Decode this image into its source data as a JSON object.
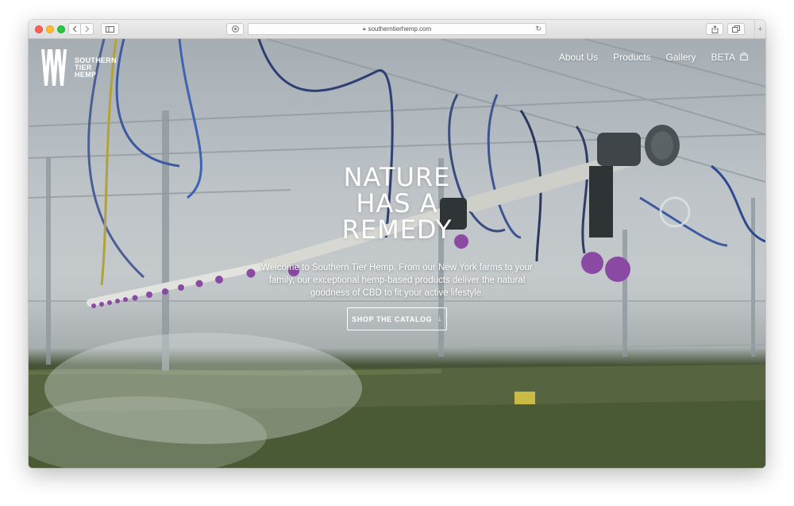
{
  "browser": {
    "url": "southerntierhemp.com",
    "icons": {
      "back": "chevron-left-icon",
      "forward": "chevron-right-icon",
      "sidebar": "sidebar-icon",
      "reader": "reader-icon",
      "lock": "lock-icon",
      "reload": "reload-icon",
      "share": "share-icon",
      "tabs": "tabs-icon",
      "new_tab": "plus-icon"
    }
  },
  "brand": {
    "logo_lines": [
      "SOUTHERN",
      "TIER",
      "HEMP"
    ]
  },
  "nav": {
    "items": [
      "About Us",
      "Products",
      "Gallery",
      "BETA"
    ],
    "cart_icon": "bag-icon"
  },
  "hero": {
    "headline": [
      "NATURE",
      "HAS A",
      "REMEDY"
    ],
    "intro": "Welcome to Southern Tier Hemp. From our New York farms to your family, our exceptional hemp-based products deliver the natural goodness of CBD to fit your active lifestyle.",
    "cta_label": "SHOP THE CATALOG",
    "cta_icon": "arrow-down-icon"
  },
  "colors": {
    "accent": "#ffffff",
    "nozzle": "#7a3f8f",
    "crop": "#55633f"
  }
}
